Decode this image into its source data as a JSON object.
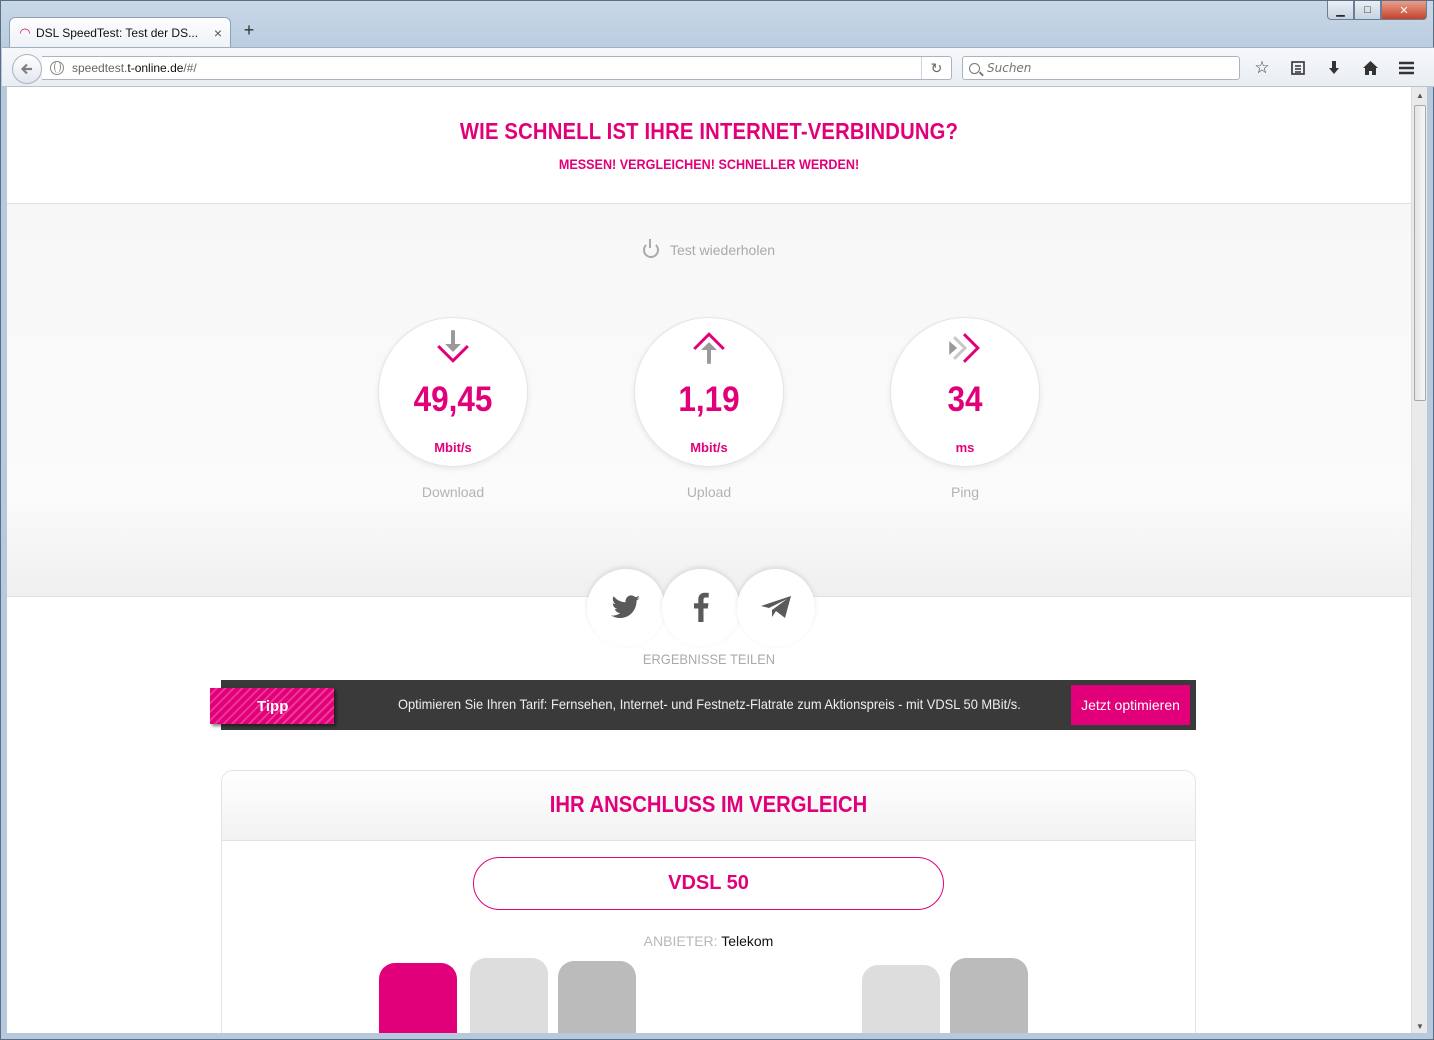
{
  "browser": {
    "tab_title": "DSL SpeedTest: Test der DS...",
    "tab_close": "×",
    "new_tab": "+",
    "url_prefix": "speedtest.",
    "url_domain": "t-online.de",
    "url_suffix": "/#/",
    "search_placeholder": "Suchen",
    "window_controls": {
      "minimize": "▁",
      "maximize": "□",
      "close": "✕"
    }
  },
  "hero": {
    "title": "WIE SCHNELL IST IHRE INTERNET-VERBINDUNG?",
    "subtitle": "MESSEN! VERGLEICHEN! SCHNELLER WERDEN!"
  },
  "results": {
    "repeat_label": "Test wiederholen",
    "download": {
      "value": "49,45",
      "unit": "Mbit/s",
      "label": "Download"
    },
    "upload": {
      "value": "1,19",
      "unit": "Mbit/s",
      "label": "Upload"
    },
    "ping": {
      "value": "34",
      "unit": "ms",
      "label": "Ping"
    }
  },
  "share": {
    "label": "ERGEBNISSE TEILEN",
    "buttons": [
      "twitter-icon",
      "facebook-icon",
      "telegram-icon"
    ]
  },
  "tipp": {
    "badge": "Tipp",
    "text": "Optimieren Sie Ihren Tarif: Fernsehen, Internet- und Festnetz-Flatrate zum Aktionspreis - mit VDSL 50 MBit/s.",
    "button": "Jetzt optimieren"
  },
  "compare": {
    "title": "IHR ANSCHLUSS IM VERGLEICH",
    "plan": "VDSL 50",
    "provider_label": "ANBIETER:",
    "provider_value": "Telekom"
  },
  "colors": {
    "brand": "#e2007a",
    "bar_light": "#dddddd",
    "bar_mid": "#bbbbbb"
  }
}
